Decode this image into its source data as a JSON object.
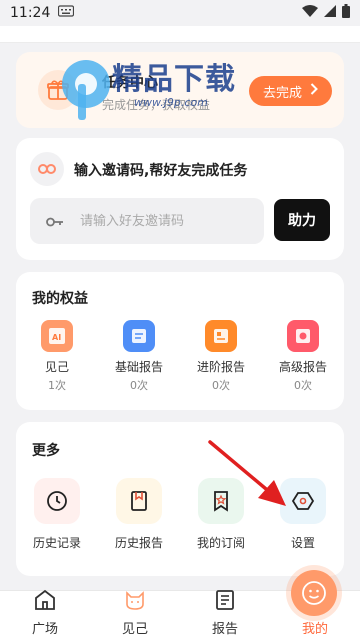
{
  "status": {
    "time": "11:24"
  },
  "task": {
    "title": "任务中心",
    "subtitle": "完成任务，获取权益",
    "button_label": "去完成",
    "watermark_text": "精品下载",
    "watermark_url": "www.j9p.com"
  },
  "invite": {
    "title": "输入邀请码,帮好友完成任务",
    "placeholder": "请输入好友邀请码",
    "button_label": "助力"
  },
  "rights": {
    "title": "我的权益",
    "items": [
      {
        "label": "见己",
        "count": "1次",
        "icon": "ai-icon",
        "color": "#ff9a6a"
      },
      {
        "label": "基础报告",
        "count": "0次",
        "icon": "basic-report-icon",
        "color": "#4f8ef7"
      },
      {
        "label": "进阶报告",
        "count": "0次",
        "icon": "advanced-report-icon",
        "color": "#ff8a2a"
      },
      {
        "label": "高级报告",
        "count": "0次",
        "icon": "premium-report-icon",
        "color": "#ff5a6a"
      }
    ]
  },
  "more": {
    "title": "更多",
    "items": [
      {
        "label": "历史记录",
        "icon": "clock-icon",
        "bg": "#fff0ee"
      },
      {
        "label": "历史报告",
        "icon": "report-icon",
        "bg": "#fff7e6"
      },
      {
        "label": "我的订阅",
        "icon": "bookmark-star-icon",
        "bg": "#eaf7ee"
      },
      {
        "label": "设置",
        "icon": "settings-hex-icon",
        "bg": "#e9f5fb"
      }
    ]
  },
  "nav": {
    "items": [
      {
        "label": "广场",
        "icon": "home-icon"
      },
      {
        "label": "见己",
        "icon": "cat-icon"
      },
      {
        "label": "报告",
        "icon": "document-icon"
      },
      {
        "label": "我的",
        "icon": "profile-face-icon"
      }
    ],
    "active_index": 3
  }
}
